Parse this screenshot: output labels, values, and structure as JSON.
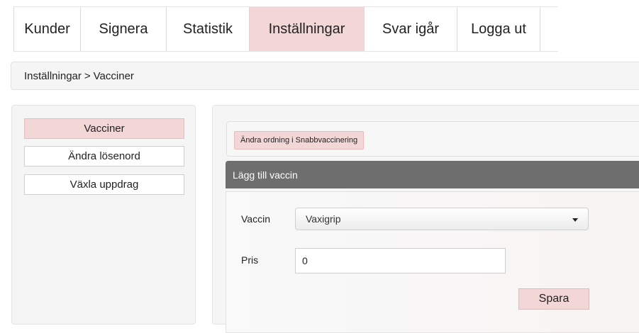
{
  "topnav": {
    "items": [
      {
        "label": "Kunder"
      },
      {
        "label": "Signera"
      },
      {
        "label": "Statistik"
      },
      {
        "label": "Inställningar",
        "active": true
      },
      {
        "label": "Svar igår"
      },
      {
        "label": "Logga ut"
      }
    ]
  },
  "breadcrumb": {
    "parent": "Inställningar",
    "separator": ">",
    "current": "Vacciner"
  },
  "sidebar": {
    "items": [
      {
        "label": "Vacciner",
        "active": true
      },
      {
        "label": "Ändra lösenord"
      },
      {
        "label": "Växla uppdrag"
      }
    ]
  },
  "main": {
    "order_button_label": "Ändra ordning i Snabbvaccinering",
    "add_header": "Lägg till vaccin",
    "form": {
      "vaccine_label": "Vaccin",
      "vaccine_selected": "Vaxigrip",
      "price_label": "Pris",
      "price_value": "0",
      "save_label": "Spara"
    }
  },
  "colors": {
    "active_bg": "#f3d6d6",
    "header_bg": "#6e6e6e",
    "panel_bg": "#f5f5f5"
  }
}
